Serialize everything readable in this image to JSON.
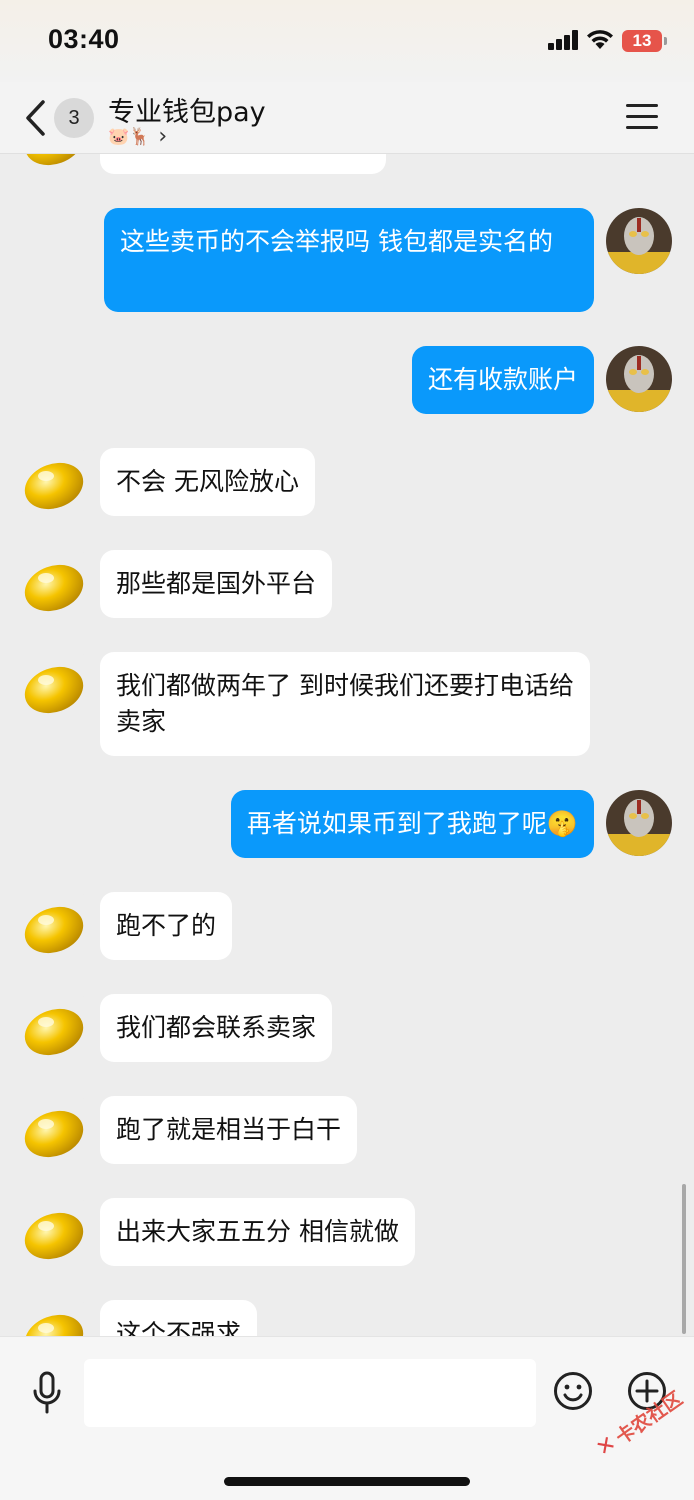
{
  "status_bar": {
    "time": "03:40",
    "battery": "13"
  },
  "header": {
    "unread_count": "3",
    "title": "专业钱包pay",
    "subtitle_icons": "🐷🦌",
    "subtitle_chevron": "›"
  },
  "messages": [
    {
      "side": "in",
      "text": ""
    },
    {
      "side": "out",
      "text": "这些卖币的不会举报吗 钱包都是实名的"
    },
    {
      "side": "out",
      "text": "还有收款账户"
    },
    {
      "side": "in",
      "text": "不会 无风险放心"
    },
    {
      "side": "in",
      "text": "那些都是国外平台"
    },
    {
      "side": "in",
      "text": "我们都做两年了 到时候我们还要打电话给卖家"
    },
    {
      "side": "out",
      "text": "再者说如果币到了我跑了呢",
      "emoji": "🤫"
    },
    {
      "side": "in",
      "text": "跑不了的"
    },
    {
      "side": "in",
      "text": "我们都会联系卖家"
    },
    {
      "side": "in",
      "text": "跑了就是相当于白干"
    },
    {
      "side": "in",
      "text": "出来大家五五分 相信就做"
    },
    {
      "side": "in",
      "text": "这个不强求"
    }
  ],
  "input": {
    "placeholder": ""
  },
  "watermark": "卡农社区",
  "icons": {
    "back": "chevron-left-icon",
    "menu": "hamburger-menu-icon",
    "voice": "microphone-icon",
    "emoji": "smiley-icon",
    "more": "plus-circle-icon"
  },
  "colors": {
    "out_bubble": "#0a99fb",
    "in_bubble": "#ffffff",
    "background": "#ededed"
  }
}
